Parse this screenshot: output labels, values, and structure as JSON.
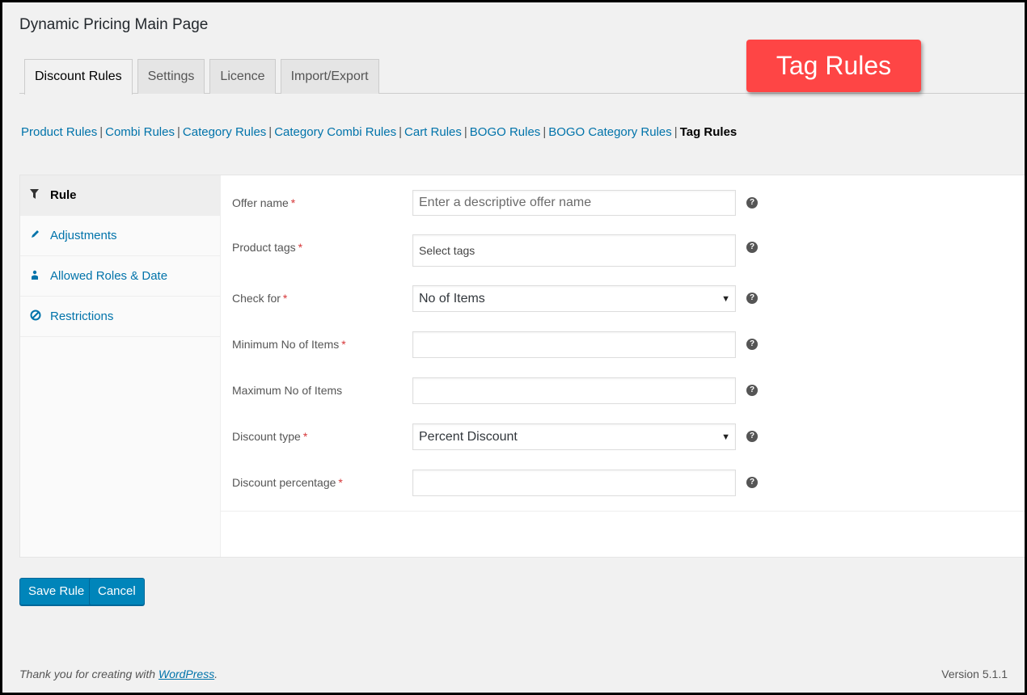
{
  "page": {
    "title": "Dynamic Pricing Main Page"
  },
  "tabs": [
    {
      "label": "Discount Rules",
      "active": true
    },
    {
      "label": "Settings",
      "active": false
    },
    {
      "label": "Licence",
      "active": false
    },
    {
      "label": "Import/Export",
      "active": false
    }
  ],
  "callout": {
    "text": "Tag Rules",
    "color": "#fe4545"
  },
  "subnav": {
    "items": [
      "Product Rules",
      "Combi Rules",
      "Category Rules",
      "Category Combi Rules",
      "Cart Rules",
      "BOGO Rules",
      "BOGO Category Rules",
      "Tag Rules"
    ],
    "separator": "|",
    "current_index": 7
  },
  "sidebar": {
    "items": [
      {
        "label": "Rule",
        "icon": "filter-icon",
        "active": true
      },
      {
        "label": "Adjustments",
        "icon": "pencil-icon",
        "active": false
      },
      {
        "label": "Allowed Roles & Date",
        "icon": "users-icon",
        "active": false
      },
      {
        "label": "Restrictions",
        "icon": "ban-icon",
        "active": false
      }
    ]
  },
  "form": {
    "required_marker": "*",
    "help_glyph": "?",
    "select_arrow": "▼",
    "fields": [
      {
        "label": "Offer name",
        "required": true,
        "type": "text",
        "value": "",
        "placeholder": "Enter a descriptive offer name"
      },
      {
        "label": "Product tags",
        "required": true,
        "type": "tags",
        "value": "",
        "placeholder": "Select tags"
      },
      {
        "label": "Check for",
        "required": true,
        "type": "select",
        "value": "No of Items"
      },
      {
        "label": "Minimum No of Items",
        "required": true,
        "type": "text",
        "value": ""
      },
      {
        "label": "Maximum No of Items",
        "required": false,
        "type": "text",
        "value": ""
      },
      {
        "label": "Discount type",
        "required": true,
        "type": "select",
        "value": "Percent Discount"
      },
      {
        "label": "Discount percentage",
        "required": true,
        "type": "text",
        "value": ""
      }
    ]
  },
  "buttons": {
    "save": "Save Rule",
    "cancel": "Cancel"
  },
  "footer": {
    "thanks_prefix": "Thank you for creating with ",
    "thanks_link": "WordPress",
    "thanks_suffix": ".",
    "version": "Version 5.1.1"
  },
  "colors": {
    "link": "#0073aa",
    "primary_button": "#0085ba",
    "required": "#d63638"
  }
}
